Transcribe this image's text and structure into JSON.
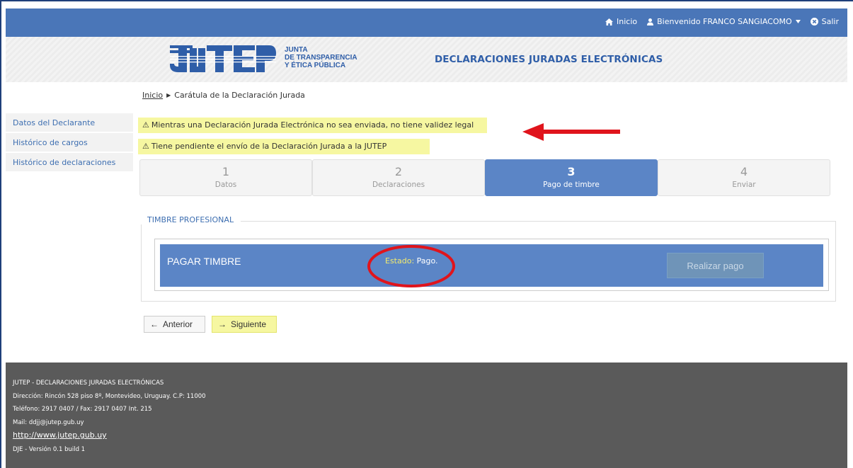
{
  "topnav": {
    "home_label": "Inicio",
    "welcome_label": "Bienvenido FRANCO SANGIACOMO",
    "logout_label": "Salir"
  },
  "header": {
    "logo_text": [
      "JUNTA",
      "DE TRANSPARENCIA",
      "Y ÉTICA PÚBLICA"
    ],
    "logo_mark": "JUTEP",
    "title": "DECLARACIONES JURADAS ELECTRÓNICAS"
  },
  "breadcrumb": {
    "home": "Inicio",
    "current": "Carátula de la Declaración Jurada"
  },
  "sidebar": {
    "items": [
      {
        "label": "Datos del Declarante"
      },
      {
        "label": "Histórico de cargos"
      },
      {
        "label": "Histórico de declaraciones"
      }
    ]
  },
  "alerts": [
    {
      "text": "Mientras una Declaración Jurada Electrónica no sea enviada, no tiene validez legal"
    },
    {
      "text": "Tiene pendiente el envío de la Declaración Jurada a la JUTEP"
    }
  ],
  "steps": [
    {
      "num": "1",
      "label": "Datos"
    },
    {
      "num": "2",
      "label": "Declaraciones"
    },
    {
      "num": "3",
      "label": "Pago de timbre",
      "active": true
    },
    {
      "num": "4",
      "label": "Enviar"
    }
  ],
  "timbre": {
    "legend": "TIMBRE PROFESIONAL",
    "title": "PAGAR TIMBRE",
    "status_key": "Estado:",
    "status_value": "Pago.",
    "pay_button": "Realizar pago"
  },
  "nav": {
    "prev_label": "Anterior",
    "next_label": "Siguiente"
  },
  "footer": {
    "line1": "JUTEP - DECLARACIONES JURADAS ELECTRÓNICAS",
    "line2": "Dirección: Rincón 528 piso 8º, Montevideo, Uruguay. C.P: 11000",
    "line3": "Teléfono: 2917 0407 / Fax: 2917 0407 Int. 215",
    "line4": "Mail: ddjj@jutep.gub.uy",
    "link": "http://www.jutep.gub.uy",
    "version": "DJE - Versión 0.1 build 1"
  },
  "colors": {
    "accent": "#4a76b8",
    "active_step": "#5b85c6",
    "alert_bg": "#f6f7a1",
    "annotation": "#e0141c",
    "footer_bg": "#5a5a5a"
  }
}
